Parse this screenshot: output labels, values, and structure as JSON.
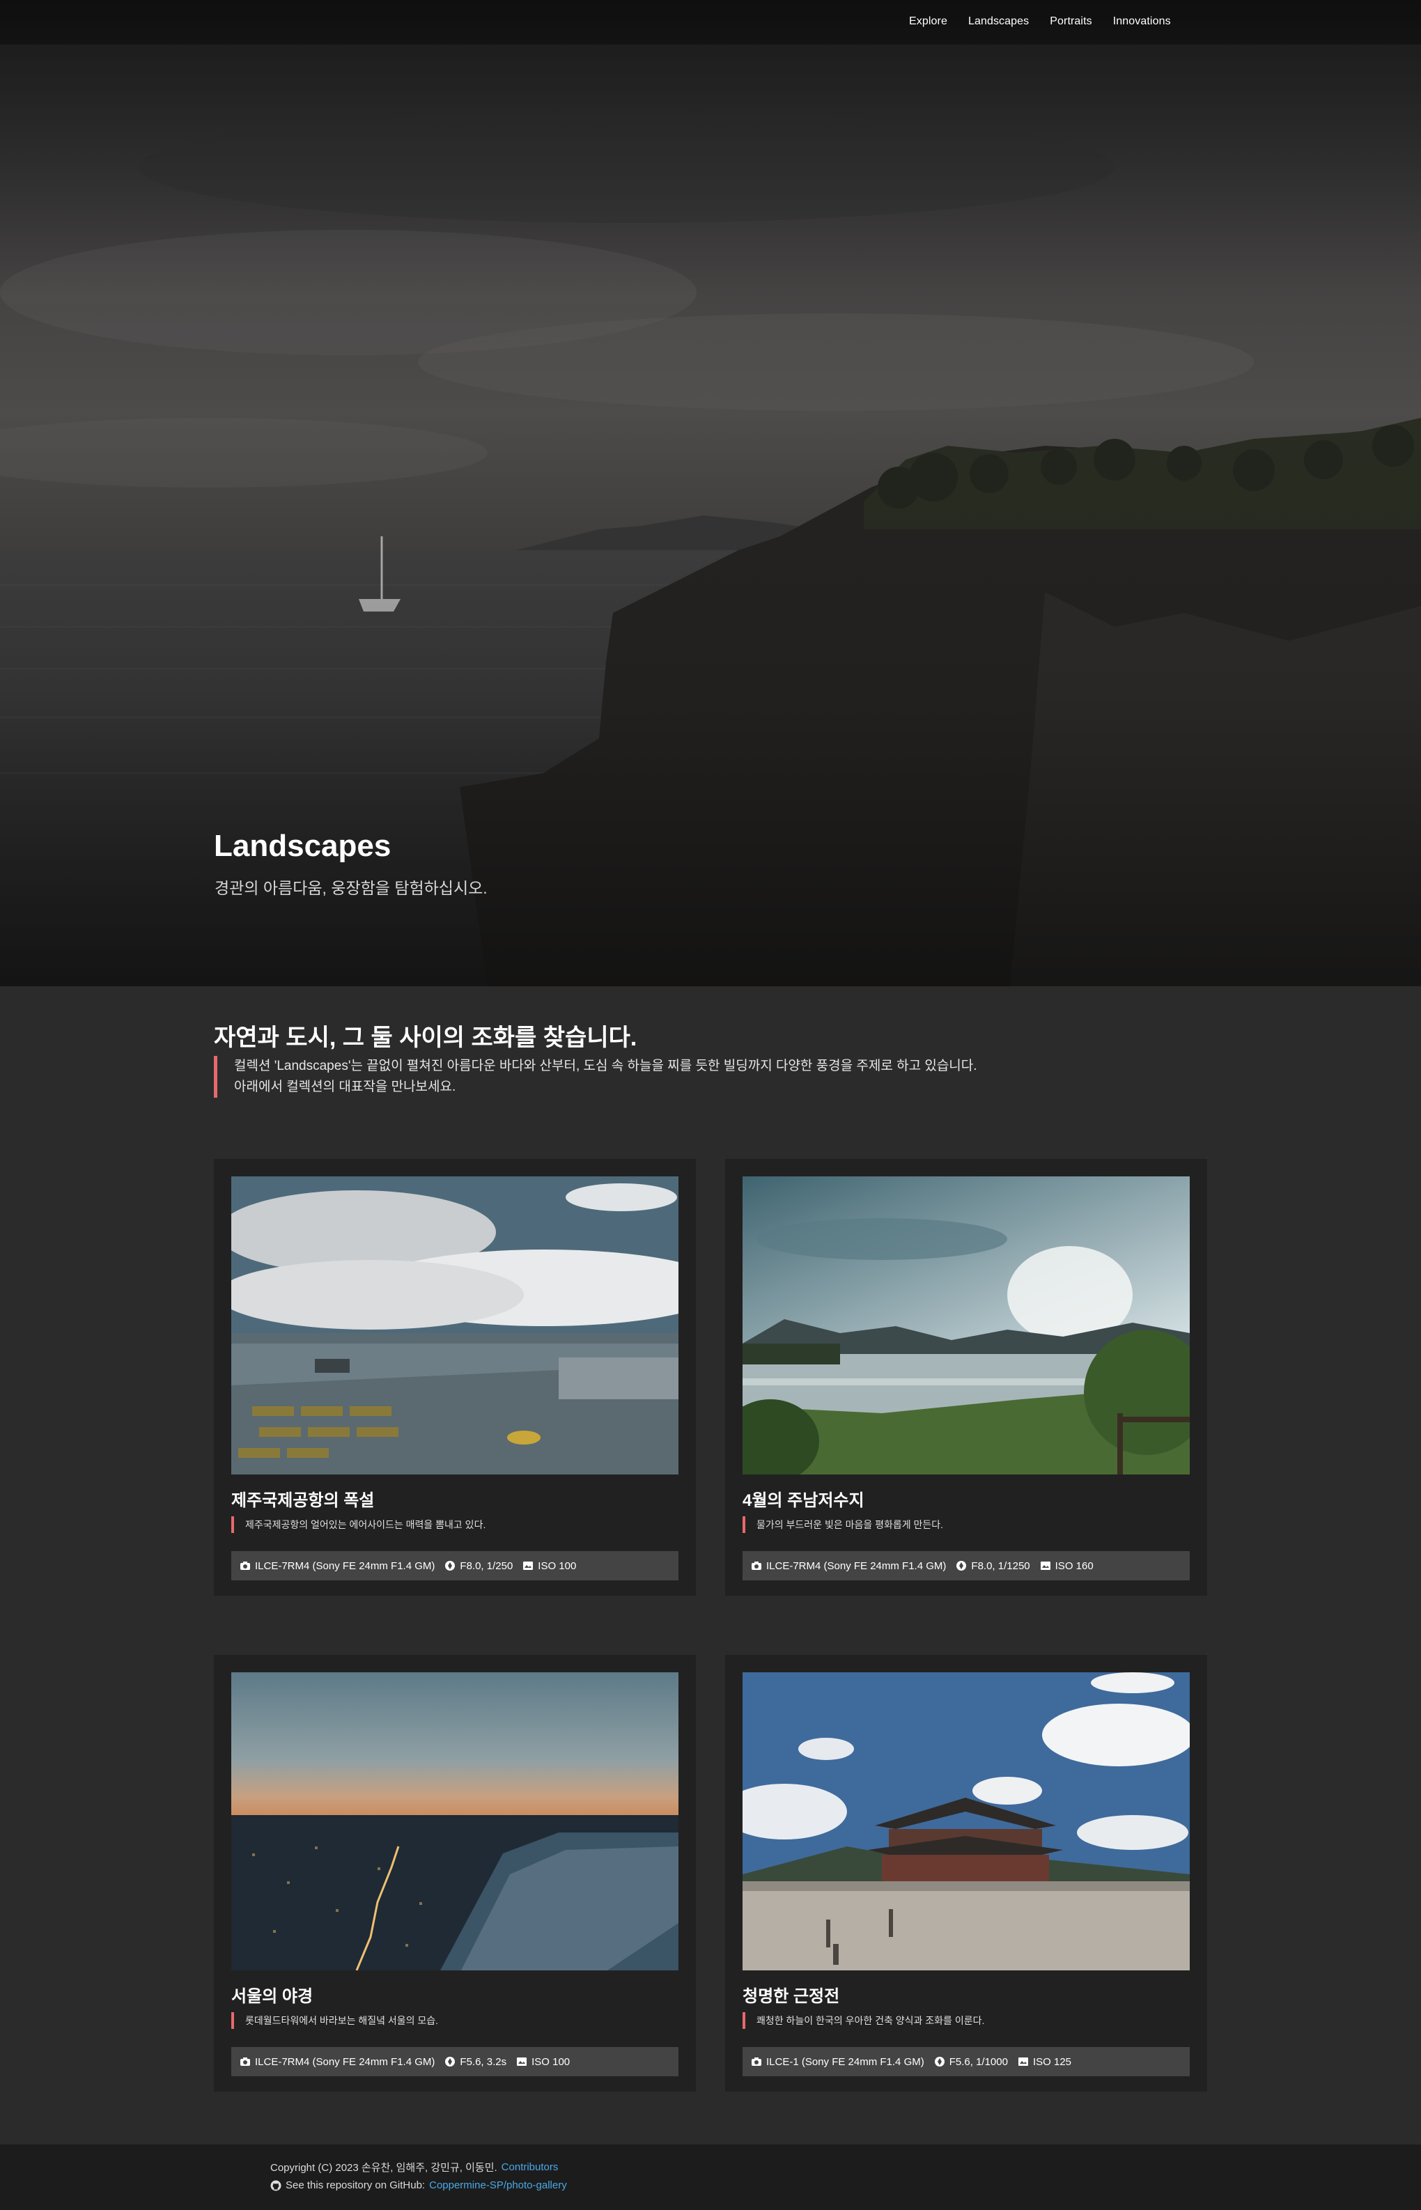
{
  "nav": {
    "items": [
      {
        "label": "Explore"
      },
      {
        "label": "Landscapes"
      },
      {
        "label": "Portraits"
      },
      {
        "label": "Innovations"
      }
    ]
  },
  "hero": {
    "title": "Landscapes",
    "subtitle": "경관의 아름다움, 웅장함을 탐험하십시오."
  },
  "intro": {
    "heading": "자연과 도시, 그 둘 사이의 조화를 찾습니다.",
    "line1": "컬렉션 'Landscapes'는 끝없이 펼쳐진 아름다운 바다와 산부터, 도심 속 하늘을 찌를 듯한 빌딩까지 다양한 풍경을 주제로 하고 있습니다.",
    "line2": "아래에서 컬렉션의 대표작을 만나보세요."
  },
  "cards": [
    {
      "title": "제주국제공항의 폭설",
      "desc": "제주국제공항의 얼어있는 에어사이드는 매력을 뽐내고 있다.",
      "camera": "ILCE-7RM4 (Sony FE 24mm F1.4 GM)",
      "exposure": "F8.0, 1/250",
      "iso": "ISO 100"
    },
    {
      "title": "4월의 주남저수지",
      "desc": "물가의 부드러운 빛은 마음을 평화롭게 만든다.",
      "camera": "ILCE-7RM4 (Sony FE 24mm F1.4 GM)",
      "exposure": "F8.0, 1/1250",
      "iso": "ISO 160"
    },
    {
      "title": "서울의 야경",
      "desc": "롯데월드타워에서 바라보는 해질녘 서울의 모습.",
      "camera": "ILCE-7RM4 (Sony FE 24mm F1.4 GM)",
      "exposure": "F5.6, 3.2s",
      "iso": "ISO 100"
    },
    {
      "title": "청명한 근정전",
      "desc": "쾌청한 하늘이 한국의 우아한 건축 양식과 조화를 이룬다.",
      "camera": "ILCE-1 (Sony FE 24mm F1.4 GM)",
      "exposure": "F5.6, 1/1000",
      "iso": "ISO 125"
    }
  ],
  "footer": {
    "copyright": "Copyright (C) 2023 손유찬, 임해주, 강민규, 이동민.",
    "contributors_link": "Contributors",
    "repo_text": "See this repository on GitHub:",
    "repo_link": "Coppermine-SP/photo-gallery"
  },
  "icons": {
    "camera": "camera-icon",
    "exposure": "aperture-icon",
    "iso": "iso-icon",
    "github": "github-icon"
  },
  "colors": {
    "accent": "#e8696b",
    "link": "#4aa8e8",
    "card_bg": "#212121",
    "meta_bg": "#444444"
  }
}
